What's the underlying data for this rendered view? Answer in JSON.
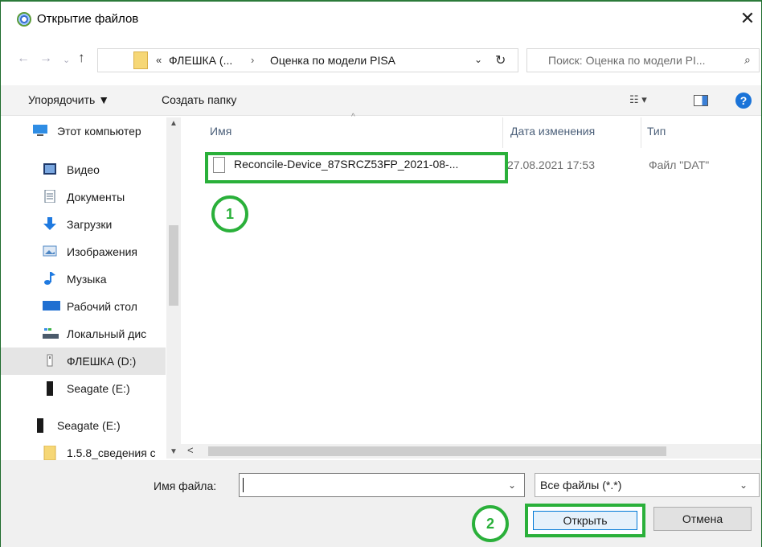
{
  "window": {
    "title": "Открытие файлов",
    "close_glyph": "✕"
  },
  "nav": {
    "back_glyph": "←",
    "forward_glyph": "→",
    "recent_glyph": "⌄",
    "up_glyph": "↑",
    "chevron": "«",
    "breadcrumbs": [
      "ФЛЕШКА (...",
      "Оценка по модели PISA"
    ],
    "separator": "›",
    "dropdown_glyph": "⌄",
    "refresh_glyph": "↻",
    "search_placeholder": "Поиск: Оценка по модели PI...",
    "search_glyph": "⌕"
  },
  "toolbar": {
    "organize_label": "Упорядочить ▼",
    "new_folder_label": "Создать папку",
    "view_glyph": "☷ ▾",
    "help_glyph": "?"
  },
  "sidebar": {
    "items": [
      {
        "label": "Этот компьютер",
        "icon": "computer-icon",
        "color": "#2f8de4"
      },
      {
        "label": "Видео",
        "icon": "video-icon",
        "color": "#1f3a6b"
      },
      {
        "label": "Документы",
        "icon": "documents-icon",
        "color": "#5a6f86"
      },
      {
        "label": "Загрузки",
        "icon": "downloads-icon",
        "color": "#1f7ae0"
      },
      {
        "label": "Изображения",
        "icon": "pictures-icon",
        "color": "#4d86c4"
      },
      {
        "label": "Музыка",
        "icon": "music-icon",
        "color": "#1f7ae0"
      },
      {
        "label": "Рабочий стол",
        "icon": "desktop-icon",
        "color": "#1f6fd1"
      },
      {
        "label": "Локальный дис",
        "icon": "local-disk-icon",
        "color": "#4b5a6b"
      },
      {
        "label": "ФЛЕШКА (D:)",
        "icon": "usb-drive-icon",
        "color": "#7a7a7a"
      },
      {
        "label": "Seagate (E:)",
        "icon": "drive-icon",
        "color": "#1a1a1a"
      },
      {
        "label": "Seagate (E:)",
        "icon": "drive-icon",
        "color": "#1a1a1a"
      },
      {
        "label": "1.5.8_сведения с",
        "icon": "folder-icon",
        "color": "#f6d776"
      }
    ],
    "scroll_up_glyph": "▲",
    "scroll_down_glyph": "▼"
  },
  "filelist": {
    "columns": [
      "Имя",
      "Дата изменения",
      "Тип"
    ],
    "sort_glyph": "^",
    "rows": [
      {
        "name": "Reconcile-Device_87SRCZ53FP_2021-08-...",
        "date": "27.08.2021 17:53",
        "type": "Файл \"DAT\""
      }
    ],
    "hscroll_left_glyph": "<",
    "hscroll_right_glyph": ">"
  },
  "annotations": {
    "badge1": "1",
    "badge2": "2",
    "accent": "#2ab03a"
  },
  "bottom": {
    "filename_label": "Имя файла:",
    "filename_value": "",
    "filename_dd_glyph": "⌄",
    "filter_value": "Все файлы (*.*)",
    "filter_dd_glyph": "⌄",
    "open_label": "Открыть",
    "cancel_label": "Отмена"
  }
}
